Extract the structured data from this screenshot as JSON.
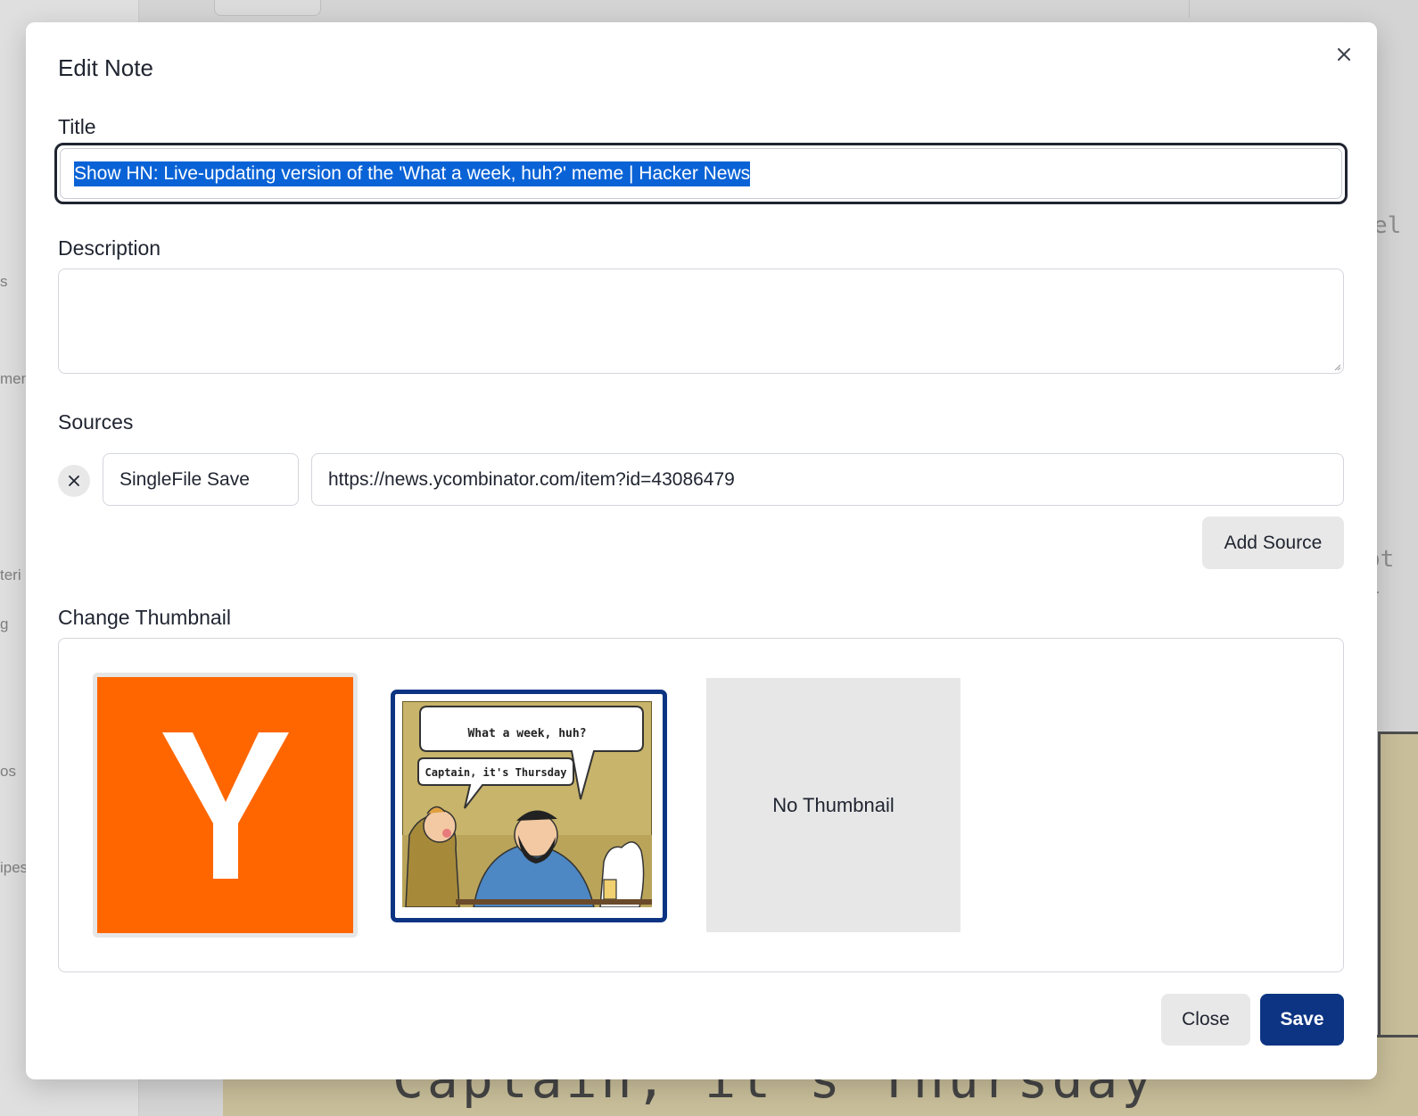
{
  "background": {
    "sidebar_fragments": [
      "s",
      "men",
      "teri",
      "g",
      "os",
      "ipes"
    ],
    "right_fragments": [
      "el",
      "ot i"
    ],
    "comic_caption": "Captain, it's Thursday"
  },
  "modal": {
    "title": "Edit Note",
    "close_icon": "close-icon"
  },
  "form": {
    "title_label": "Title",
    "title_value": "Show HN: Live-updating version of the 'What a week, huh?' meme | Hacker News",
    "description_label": "Description",
    "description_value": "",
    "sources_label": "Sources",
    "sources": [
      {
        "type": "SingleFile Save",
        "url": "https://news.ycombinator.com/item?id=43086479"
      }
    ],
    "add_source_label": "Add Source",
    "thumbnail_label": "Change Thumbnail",
    "thumbnails": {
      "yc_letter": "Y",
      "comic_bubble_top": "What a week, huh?",
      "comic_bubble_bottom": "Captain, it's Thursday",
      "none_label": "No Thumbnail"
    }
  },
  "footer": {
    "close_label": "Close",
    "save_label": "Save"
  },
  "colors": {
    "primary": "#0d3483",
    "selection": "#0a63d6",
    "yc_orange": "#ff6600"
  }
}
